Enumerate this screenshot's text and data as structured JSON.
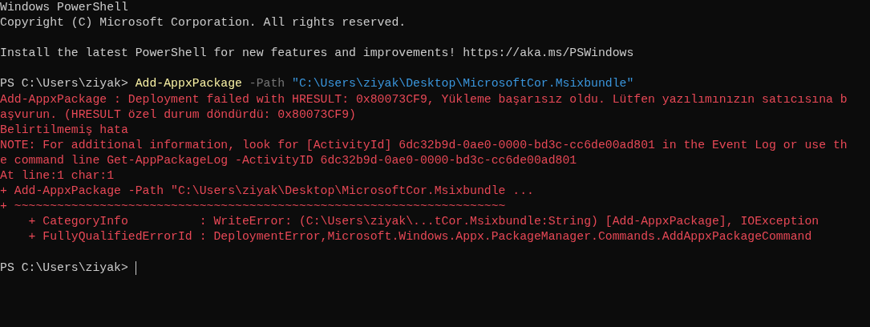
{
  "lines": [
    {
      "kind": "text",
      "segments": [
        {
          "kind": "output",
          "text": "Windows PowerShell"
        }
      ]
    },
    {
      "kind": "text",
      "segments": [
        {
          "kind": "output",
          "text": "Copyright (C) Microsoft Corporation. All rights reserved."
        }
      ]
    },
    {
      "kind": "blank"
    },
    {
      "kind": "text",
      "segments": [
        {
          "kind": "output",
          "text": "Install the latest PowerShell for new features and improvements! https://aka.ms/PSWindows"
        }
      ]
    },
    {
      "kind": "blank"
    },
    {
      "kind": "text",
      "segments": [
        {
          "kind": "output",
          "text": "PS C:\\Users\\ziyak> "
        },
        {
          "kind": "command",
          "text": "Add-AppxPackage"
        },
        {
          "kind": "parameter",
          "text": " -Path"
        },
        {
          "kind": "string",
          "text": " \"C:\\Users\\ziyak\\Desktop\\MicrosoftCor.Msixbundle\""
        }
      ]
    },
    {
      "kind": "text",
      "segments": [
        {
          "kind": "error",
          "text": "Add-AppxPackage : Deployment failed with HRESULT: 0x80073CF9, Yükleme başarısız oldu. Lütfen yazılımınızın satıcısına b"
        }
      ]
    },
    {
      "kind": "text",
      "segments": [
        {
          "kind": "error",
          "text": "aşvurun. (HRESULT özel durum döndürdü: 0x80073CF9)"
        }
      ]
    },
    {
      "kind": "text",
      "segments": [
        {
          "kind": "error",
          "text": "Belirtilmemiş hata"
        }
      ]
    },
    {
      "kind": "text",
      "segments": [
        {
          "kind": "error",
          "text": "NOTE: For additional information, look for [ActivityId] 6dc32b9d-0ae0-0000-bd3c-cc6de00ad801 in the Event Log or use th"
        }
      ]
    },
    {
      "kind": "text",
      "segments": [
        {
          "kind": "error",
          "text": "e command line Get-AppPackageLog -ActivityID 6dc32b9d-0ae0-0000-bd3c-cc6de00ad801"
        }
      ]
    },
    {
      "kind": "text",
      "segments": [
        {
          "kind": "error",
          "text": "At line:1 char:1"
        }
      ]
    },
    {
      "kind": "text",
      "segments": [
        {
          "kind": "error",
          "text": "+ Add-AppxPackage -Path \"C:\\Users\\ziyak\\Desktop\\MicrosoftCor.Msixbundle ..."
        }
      ]
    },
    {
      "kind": "text",
      "segments": [
        {
          "kind": "error",
          "text": "+ ~~~~~~~~~~~~~~~~~~~~~~~~~~~~~~~~~~~~~~~~~~~~~~~~~~~~~~~~~~~~~~~~~~~~~"
        }
      ]
    },
    {
      "kind": "text",
      "segments": [
        {
          "kind": "error",
          "text": "    + CategoryInfo          : WriteError: (C:\\Users\\ziyak\\...tCor.Msixbundle:String) [Add-AppxPackage], IOException"
        }
      ]
    },
    {
      "kind": "text",
      "segments": [
        {
          "kind": "error",
          "text": "    + FullyQualifiedErrorId : DeploymentError,Microsoft.Windows.Appx.PackageManager.Commands.AddAppxPackageCommand"
        }
      ]
    },
    {
      "kind": "blank"
    },
    {
      "kind": "text",
      "cursor": true,
      "segments": [
        {
          "kind": "output",
          "text": "PS C:\\Users\\ziyak> "
        }
      ]
    }
  ]
}
